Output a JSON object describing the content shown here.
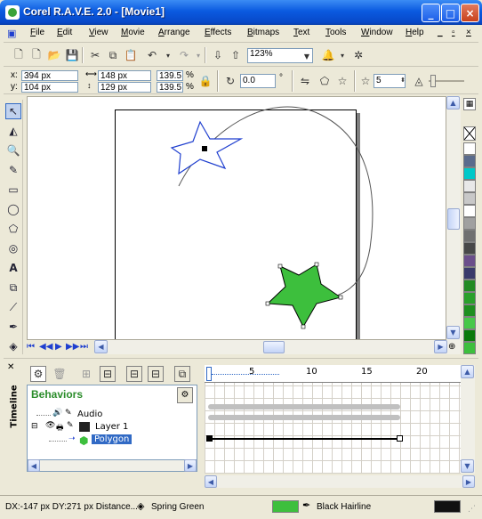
{
  "window": {
    "title": "Corel R.A.V.E. 2.0 - [Movie1]",
    "minimize_label": "_",
    "maximize_label": "□",
    "close_label": "×"
  },
  "menu": {
    "items": [
      "File",
      "Edit",
      "View",
      "Movie",
      "Arrange",
      "Effects",
      "Bitmaps",
      "Text",
      "Tools",
      "Window",
      "Help"
    ],
    "doc_controls": [
      "_",
      "▫",
      "×"
    ]
  },
  "standard_toolbar": {
    "zoom_value": "123%"
  },
  "property_bar": {
    "x_label": "x:",
    "x_value": "394 px",
    "y_label": "y:",
    "y_value": "104 px",
    "width_value": "148 px",
    "height_value": "129 px",
    "scale_x": "139.5",
    "scale_y": "139.5",
    "percent": "%",
    "rotation_value": "0.0",
    "degree": "°",
    "points_value": "5"
  },
  "colors": {
    "star_outline": "#1f3fcf",
    "star_fill": "#3dbf3d",
    "accent_blue": "#0a5ae0"
  },
  "palette": [
    "#ffffff",
    "#5a6b8c",
    "#00c8c8",
    "#e8e8e8",
    "#c8c8c8",
    "#ffffff",
    "#a0a0a0",
    "#707070",
    "#484848",
    "#6b4e8a",
    "#3a3a6a",
    "#228b22",
    "#2aa02a",
    "#1e8f1e",
    "#48c848",
    "#0a7a0a",
    "#3dbf3d"
  ],
  "timeline": {
    "vertical_label": "Timeline",
    "behaviors_title": "Behaviors",
    "ruler_marks": [
      "5",
      "10",
      "15",
      "20"
    ],
    "tree": [
      {
        "label": "Audio"
      },
      {
        "label": "Layer 1"
      },
      {
        "label": "Polygon"
      }
    ]
  },
  "statusbar": {
    "coords": "DX:-147 px DY:271 px Distance...",
    "fill_name": "Spring Green",
    "outline_name": "Black Hairline"
  }
}
